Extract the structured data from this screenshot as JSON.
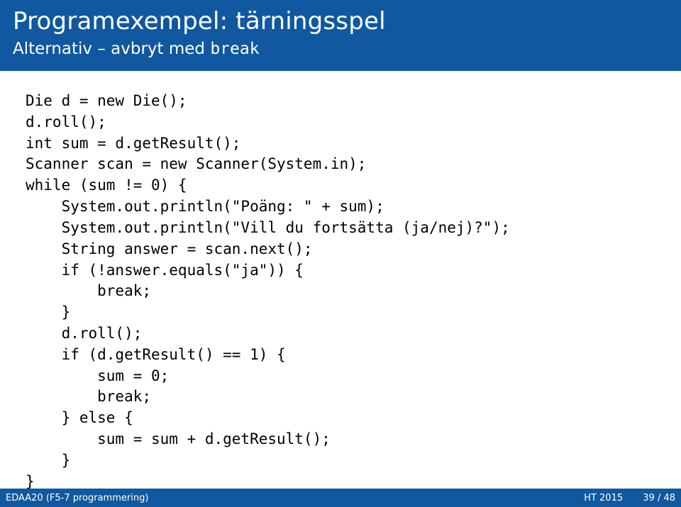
{
  "header": {
    "title": "Programexempel: tärningsspel",
    "subtitle_prefix": "Alternativ – avbryt med ",
    "subtitle_code": "break"
  },
  "code": "Die d = new Die();\nd.roll();\nint sum = d.getResult();\nScanner scan = new Scanner(System.in);\nwhile (sum != 0) {\n    System.out.println(\"Poäng: \" + sum);\n    System.out.println(\"Vill du fortsätta (ja/nej)?\");\n    String answer = scan.next();\n    if (!answer.equals(\"ja\")) {\n        break;\n    }\n    d.roll();\n    if (d.getResult() == 1) {\n        sum = 0;\n        break;\n    } else {\n        sum = sum + d.getResult();\n    }\n}",
  "footer": {
    "course": "EDAA20 (F5-7 programmering)",
    "term": "HT 2015",
    "page": "39 / 48"
  }
}
